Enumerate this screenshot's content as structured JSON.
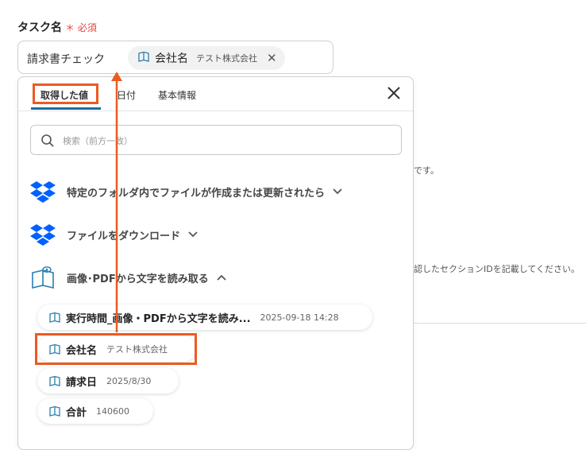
{
  "field": {
    "label": "タスク名",
    "required_mark": "＊",
    "required_text": "必須",
    "prefix_text": "請求書チェック",
    "chip": {
      "name": "会社名",
      "value": "テスト株式会社"
    }
  },
  "background_snippets": [
    "です。",
    "認したセクションIDを記載してください。"
  ],
  "panel": {
    "tabs": [
      "取得した値",
      "日付",
      "基本情報"
    ],
    "active_tab": 0,
    "search_placeholder": "検索（前方一致）",
    "groups": [
      {
        "icon": "dropbox-icon",
        "title": "特定のフォルダ内でファイルが作成または更新されたら",
        "expanded": false
      },
      {
        "icon": "dropbox-icon",
        "title": "ファイルをダウンロード",
        "expanded": false
      },
      {
        "icon": "ocr-book-icon",
        "title": "画像･PDFから文字を読み取る",
        "expanded": true
      }
    ],
    "items": [
      {
        "name": "実行時間_画像・PDFから文字を読み...",
        "value": "2025-09-18 14:28"
      },
      {
        "name": "会社名",
        "value": "テスト株式会社"
      },
      {
        "name": "請求日",
        "value": "2025/8/30"
      },
      {
        "name": "合計",
        "value": "140600"
      }
    ]
  },
  "colors": {
    "highlight": "#ec5a21",
    "tab_underline": "#1c6ea4",
    "required": "#e0463c",
    "dropbox": "#0061fe"
  }
}
